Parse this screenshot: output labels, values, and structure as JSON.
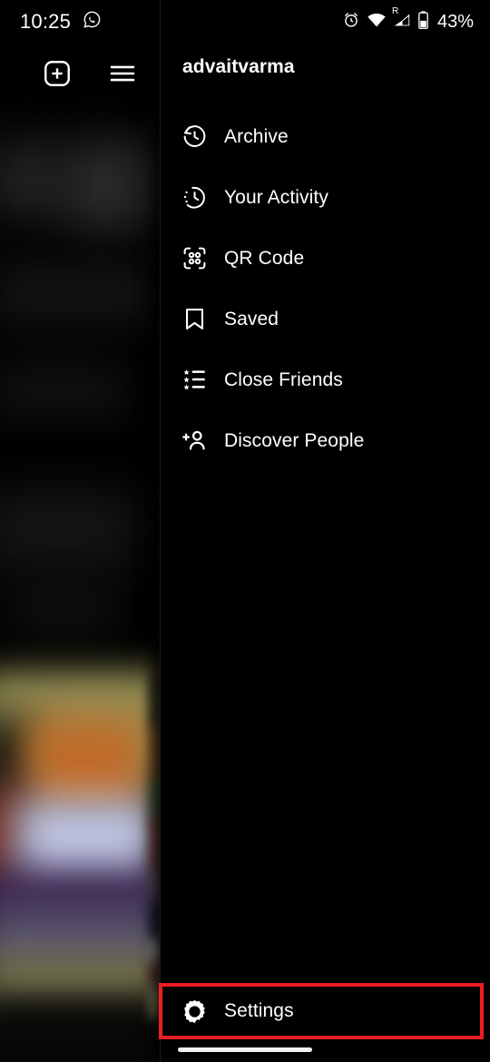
{
  "status_bar": {
    "time": "10:25",
    "app_icon": "whatsapp-icon",
    "alarm_icon": "alarm-clock-icon",
    "wifi_icon": "wifi-icon",
    "signal_icon": "cellular-signal-icon",
    "roaming_label": "R",
    "battery_icon": "battery-icon",
    "battery_percent": "43%"
  },
  "background_app": {
    "new_post_icon": "plus-square-icon",
    "menu_icon": "hamburger-menu-icon"
  },
  "drawer": {
    "username": "advaitvarma",
    "items": [
      {
        "label": "Archive",
        "icon": "archive-clock-icon"
      },
      {
        "label": "Your Activity",
        "icon": "activity-clock-icon"
      },
      {
        "label": "QR Code",
        "icon": "qr-code-icon"
      },
      {
        "label": "Saved",
        "icon": "bookmark-icon"
      },
      {
        "label": "Close Friends",
        "icon": "star-list-icon"
      },
      {
        "label": "Discover People",
        "icon": "person-add-icon"
      }
    ],
    "settings": {
      "label": "Settings",
      "icon": "gear-icon",
      "highlighted": true
    }
  },
  "colors": {
    "background": "#000000",
    "text": "#ffffff",
    "highlight_box": "#ee1d25",
    "home_indicator": "#f2f2f2"
  },
  "system": {
    "home_indicator": "home-gesture-bar"
  }
}
